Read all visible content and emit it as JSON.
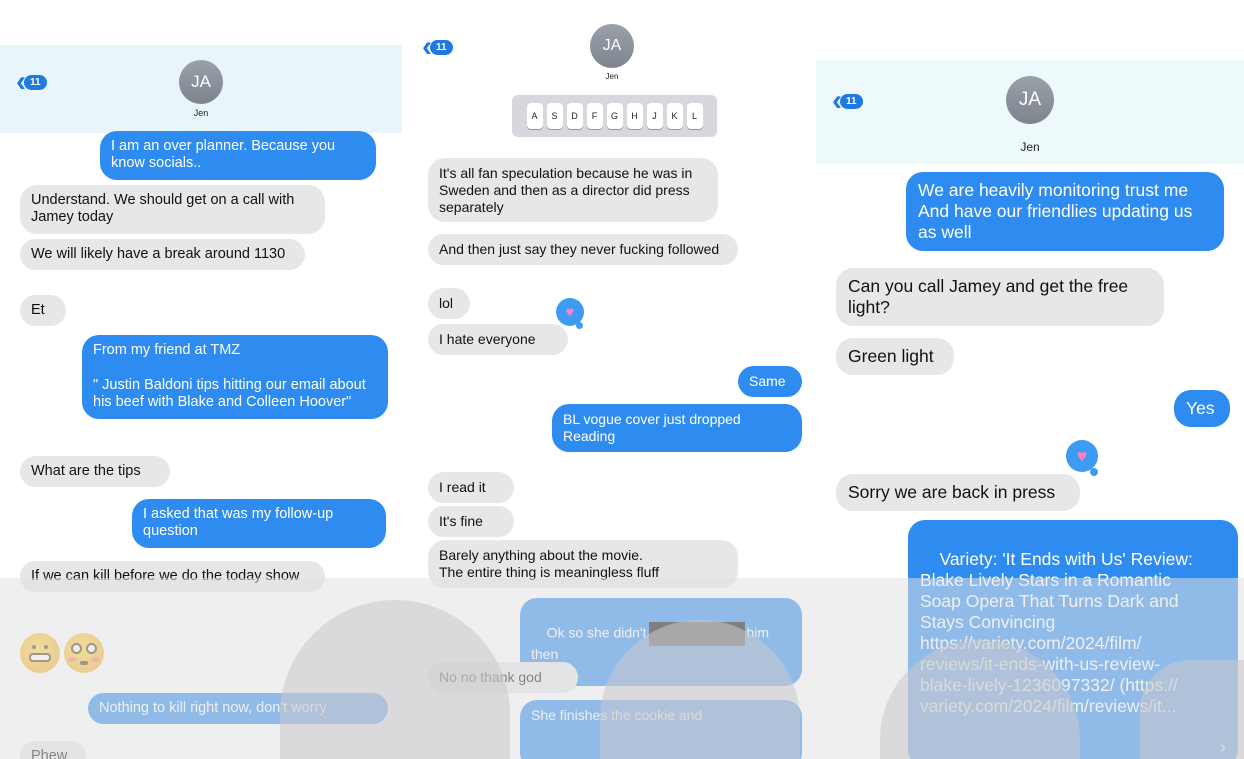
{
  "contact": {
    "initials": "JA",
    "name": "Jen",
    "unread": "11"
  },
  "left": {
    "messages": [
      {
        "dir": "out",
        "text": "I am an over planner. Because you know socials.."
      },
      {
        "dir": "in",
        "text": "Understand. We should get on a call with Jamey today"
      },
      {
        "dir": "in",
        "text": "We will likely have a break around 1130"
      },
      {
        "dir": "in",
        "text": "Et"
      },
      {
        "dir": "out",
        "text": "From my friend at TMZ\n\n\" Justin Baldoni tips hitting our email about his beef with Blake and Colleen Hoover\""
      },
      {
        "dir": "in",
        "text": "What are the tips"
      },
      {
        "dir": "out",
        "text": "I asked that was my follow-up question"
      },
      {
        "dir": "in",
        "text": "If we can kill before we do the today show"
      },
      {
        "dir": "out",
        "text": "Nothing to kill right now, don't worry"
      },
      {
        "dir": "in",
        "text": "Phew"
      }
    ],
    "emojis": [
      "grimacing-face",
      "flushed-face"
    ]
  },
  "middle": {
    "keys": [
      "A",
      "S",
      "D",
      "F",
      "G",
      "H",
      "J",
      "K",
      "L"
    ],
    "messages": [
      {
        "dir": "in",
        "text": "It's all fan speculation because he was in Sweden and then as a director did press separately"
      },
      {
        "dir": "in",
        "text": "And then just say they never fucking followed"
      },
      {
        "dir": "in",
        "text": "lol"
      },
      {
        "dir": "in",
        "text": "I hate everyone"
      },
      {
        "dir": "out",
        "text": "Same"
      },
      {
        "dir": "out",
        "text": "BL vogue cover just dropped\nReading"
      },
      {
        "dir": "in",
        "text": "I read it"
      },
      {
        "dir": "in",
        "text": "It's fine"
      },
      {
        "dir": "in",
        "text": "Barely anything about the movie.\nThe entire thing is meaningless fluff"
      },
      {
        "dir": "out",
        "text_before": "Ok so she didn't",
        "text_after": "him\nthen"
      },
      {
        "dir": "in",
        "text": "No no thank god"
      },
      {
        "dir": "out",
        "text": "She finishes the cookie and"
      }
    ]
  },
  "right": {
    "messages": [
      {
        "dir": "out",
        "text": "We are heavily monitoring trust me\nAnd have our friendlies updating us\nas well"
      },
      {
        "dir": "in",
        "text": "Can you call Jamey and get the free\nlight?"
      },
      {
        "dir": "in",
        "text": "Green light"
      },
      {
        "dir": "out",
        "text": "Yes"
      },
      {
        "dir": "in",
        "text": "Sorry we are back in press"
      },
      {
        "dir": "out",
        "text": "Variety: 'It Ends with Us' Review:\nBlake Lively Stars in a Romantic\nSoap Opera That Turns Dark and\nStays Convincing\nhttps://variety.com/2024/film/\nreviews/it-ends-with-us-review-\nblake-lively-1236097332/ (https://\nvariety.com/2024/film/reviews/it...",
        "chevron": "›"
      }
    ]
  },
  "colors": {
    "outgoing": "#2e8cf0",
    "incoming": "#e7e7ea",
    "accent": "#1f7ae0"
  }
}
